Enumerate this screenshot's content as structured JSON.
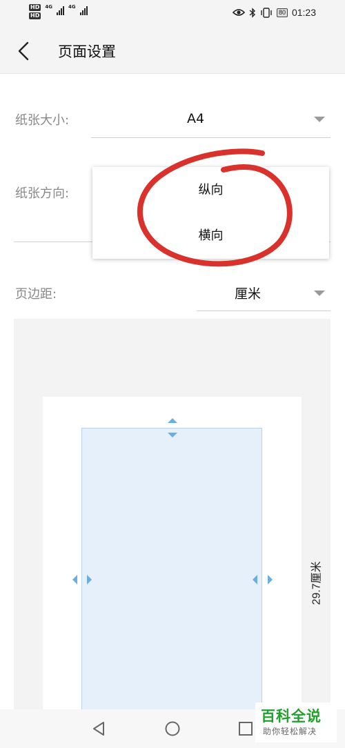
{
  "status_bar": {
    "hd1": "HD",
    "hd2": "HD",
    "net1": "4G",
    "net2": "4G",
    "battery": "80",
    "time": "01:23",
    "icons": [
      "eye-icon",
      "bluetooth-icon",
      "vibrate-icon",
      "battery-icon"
    ]
  },
  "header": {
    "title": "页面设置",
    "back_icon": "chevron-left-icon"
  },
  "paper_size": {
    "label": "纸张大小:",
    "value": "A4"
  },
  "orientation": {
    "label": "纸张方向:",
    "options": [
      "纵向",
      "横向"
    ]
  },
  "margins": {
    "label": "页边距:",
    "unit": "厘米"
  },
  "preview": {
    "height_label": "29.7厘米"
  },
  "watermark": {
    "title": "百科全说",
    "subtitle": "助你轻松解决"
  },
  "colors": {
    "annotation": "#d9322c",
    "handle": "#6aaee6",
    "content_fill": "#e6f0fa"
  }
}
